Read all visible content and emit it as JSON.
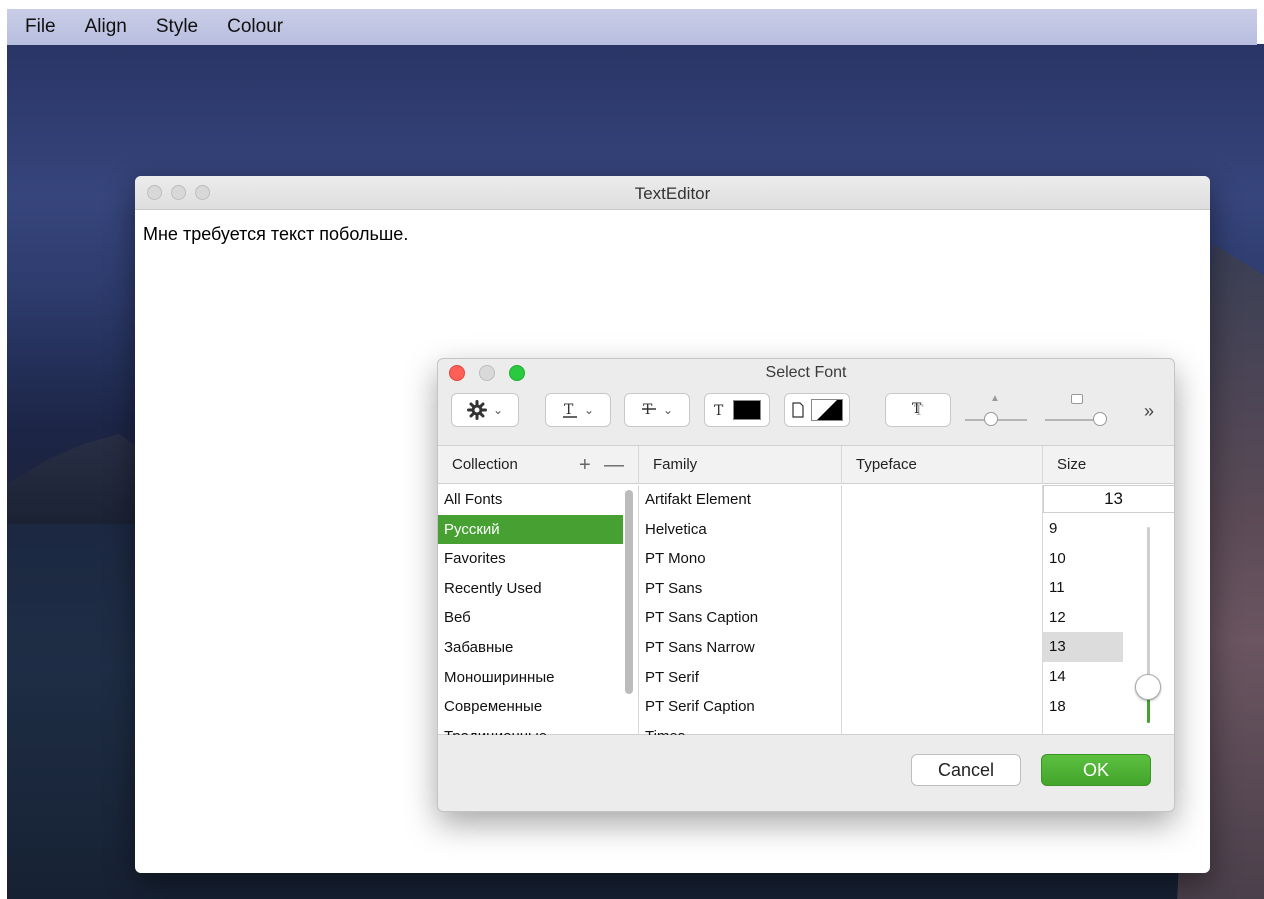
{
  "menubar": {
    "items": [
      {
        "label": "File"
      },
      {
        "label": "Align"
      },
      {
        "label": "Style"
      },
      {
        "label": "Colour"
      }
    ]
  },
  "window": {
    "title": "TextEditor",
    "document_text": "Мне требуется текст побольше."
  },
  "font_panel": {
    "title": "Select Font",
    "toolbar": {
      "more_label": "»",
      "text_color": "#000000",
      "document_color": "#000000"
    },
    "columns": {
      "collection": "Collection",
      "family": "Family",
      "typeface": "Typeface",
      "size": "Size"
    },
    "add_label": "+",
    "remove_label": "—",
    "collections": [
      {
        "label": "All Fonts",
        "selected": false
      },
      {
        "label": "Русский",
        "selected": true
      },
      {
        "label": "Favorites",
        "selected": false
      },
      {
        "label": "Recently Used",
        "selected": false
      },
      {
        "label": "Веб",
        "selected": false
      },
      {
        "label": "Забавные",
        "selected": false
      },
      {
        "label": "Моноширинные",
        "selected": false
      },
      {
        "label": "Современные",
        "selected": false
      },
      {
        "label": "Традиционные",
        "selected": false
      }
    ],
    "families": [
      "Artifakt Element",
      "Helvetica",
      "PT Mono",
      "PT Sans",
      "PT Sans Caption",
      "PT Sans Narrow",
      "PT Serif",
      "PT Serif Caption",
      "Times"
    ],
    "size_value": "13",
    "sizes": [
      "9",
      "10",
      "11",
      "12",
      "13",
      "14",
      "18"
    ],
    "selected_size": "13",
    "cancel_label": "Cancel",
    "ok_label": "OK",
    "accent_color": "#46a032"
  }
}
